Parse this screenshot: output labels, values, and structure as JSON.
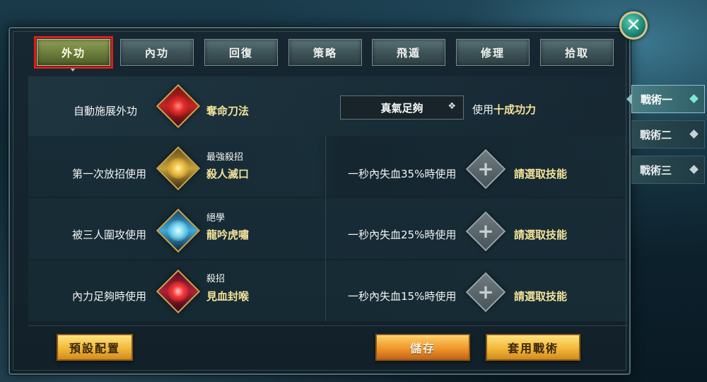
{
  "tabs": [
    {
      "label": "外功",
      "active": true
    },
    {
      "label": "內功",
      "active": false
    },
    {
      "label": "回復",
      "active": false
    },
    {
      "label": "策略",
      "active": false
    },
    {
      "label": "飛遁",
      "active": false
    },
    {
      "label": "修理",
      "active": false
    },
    {
      "label": "拾取",
      "active": false
    }
  ],
  "close_icon": "close-icon",
  "auto_cast": {
    "label": "自動施展外功",
    "skill_name": "奪命刀法",
    "dropdown_value": "真氣足夠",
    "use_prefix": "使用",
    "use_power": "十成功力"
  },
  "rules": [
    {
      "condition": "第一次放招使用",
      "skill_type": "最強殺招",
      "skill_name": "殺人滅口",
      "hp_condition": "一秒內失血35%時使用",
      "select_label": "請選取技能"
    },
    {
      "condition": "被三人圍攻使用",
      "skill_type": "絕學",
      "skill_name": "龍吟虎嘯",
      "hp_condition": "一秒內失血25%時使用",
      "select_label": "請選取技能"
    },
    {
      "condition": "內力足夠時使用",
      "skill_type": "殺招",
      "skill_name": "見血封喉",
      "hp_condition": "一秒內失血15%時使用",
      "select_label": "請選取技能"
    }
  ],
  "buttons": {
    "default_config": "預設配置",
    "save": "儲存",
    "apply_tactic": "套用戰術"
  },
  "tactics": [
    {
      "label": "戰術一",
      "active": true
    },
    {
      "label": "戰術二",
      "active": false
    },
    {
      "label": "戰術三",
      "active": false
    }
  ]
}
